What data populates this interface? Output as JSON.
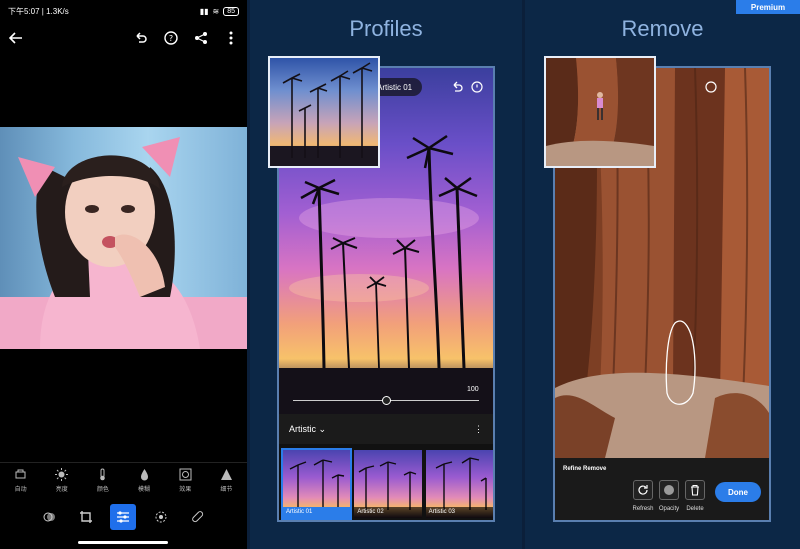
{
  "status_bar": {
    "time_speed": "下午5:07 | 1.3K/s",
    "battery": "85"
  },
  "editor": {
    "tools": [
      {
        "label": "自动",
        "icon": "auto-icon"
      },
      {
        "label": "亮度",
        "icon": "sun-icon"
      },
      {
        "label": "颜色",
        "icon": "thermometer-icon"
      },
      {
        "label": "模糊",
        "icon": "drop-icon"
      },
      {
        "label": "效果",
        "icon": "vignette-icon"
      },
      {
        "label": "细节",
        "icon": "triangle-icon"
      }
    ],
    "modes": [
      "presets-icon",
      "crop-icon",
      "adjust-icon",
      "selective-icon",
      "healing-icon"
    ],
    "active_mode": 2
  },
  "profiles": {
    "title": "Profiles",
    "pill_label": "Artistic 01",
    "slider_value": "100",
    "slider_fraction": 0.5,
    "dropdown_label": "Artistic",
    "thumbnails": [
      "Artistic 01",
      "Artistic 02",
      "Artistic 03"
    ],
    "selected": 0
  },
  "remove": {
    "title": "Remove",
    "premium_badge": "Premium",
    "refine_title": "Refine Remove",
    "controls": [
      "Refresh",
      "Opacity",
      "Delete"
    ],
    "done_label": "Done"
  },
  "colors": {
    "accent": "#2b7de9",
    "title": "#8fb3e0",
    "panel_bg": "#0c2746"
  }
}
